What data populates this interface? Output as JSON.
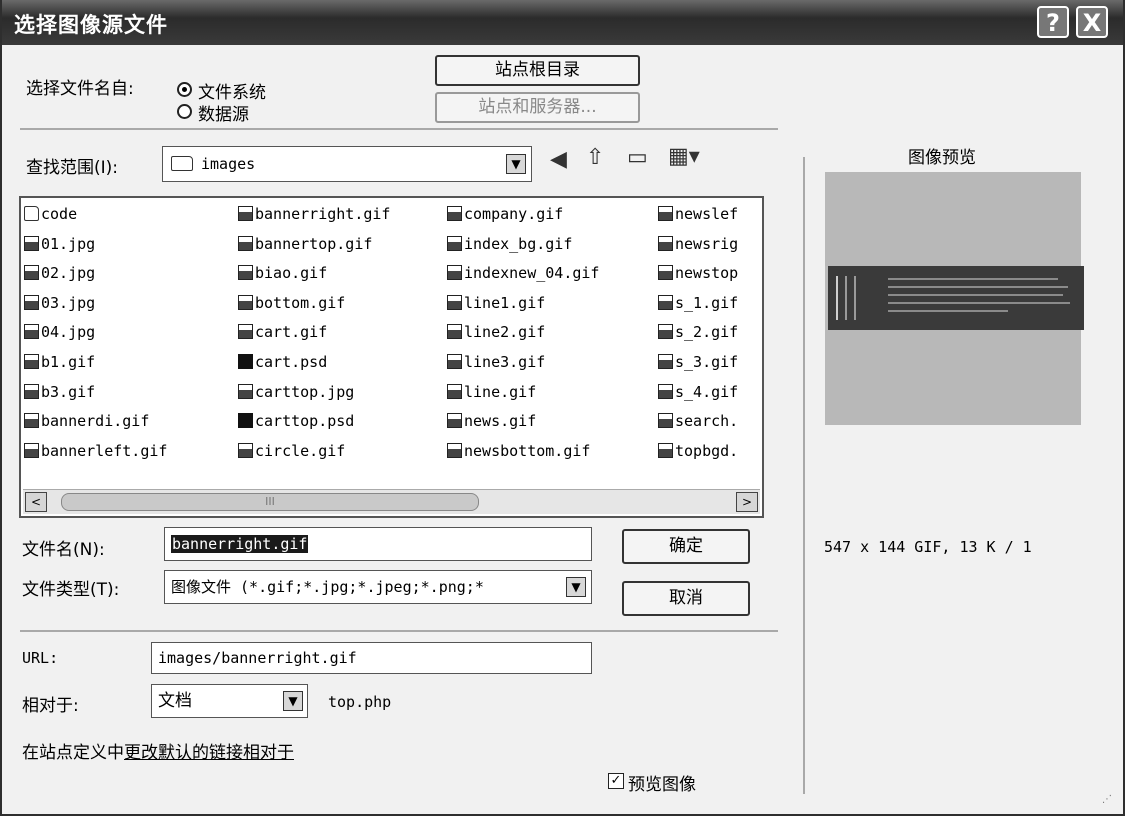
{
  "window": {
    "title": "选择图像源文件",
    "help_glyph": "?",
    "close_glyph": "X"
  },
  "source": {
    "label": "选择文件名自:",
    "options": [
      "文件系统",
      "数据源"
    ],
    "selected": "文件系统",
    "site_root_button": "站点根目录",
    "sites_servers_button": "站点和服务器..."
  },
  "lookin": {
    "label": "查找范围(I):",
    "value": "images"
  },
  "toolbar_icons": [
    "back-icon",
    "up-folder-icon",
    "new-folder-icon",
    "view-menu-icon"
  ],
  "files": {
    "columns": [
      [
        {
          "name": "code",
          "icon": "folder"
        },
        {
          "name": "01.jpg",
          "icon": "image"
        },
        {
          "name": "02.jpg",
          "icon": "image"
        },
        {
          "name": "03.jpg",
          "icon": "image"
        },
        {
          "name": "04.jpg",
          "icon": "image"
        },
        {
          "name": "b1.gif",
          "icon": "image"
        },
        {
          "name": "b3.gif",
          "icon": "image"
        },
        {
          "name": "bannerdi.gif",
          "icon": "image"
        },
        {
          "name": "bannerleft.gif",
          "icon": "image"
        }
      ],
      [
        {
          "name": "bannerright.gif",
          "icon": "image"
        },
        {
          "name": "bannertop.gif",
          "icon": "image"
        },
        {
          "name": "biao.gif",
          "icon": "image"
        },
        {
          "name": "bottom.gif",
          "icon": "image"
        },
        {
          "name": "cart.gif",
          "icon": "image"
        },
        {
          "name": "cart.psd",
          "icon": "psd"
        },
        {
          "name": "carttop.jpg",
          "icon": "image"
        },
        {
          "name": "carttop.psd",
          "icon": "psd"
        },
        {
          "name": "circle.gif",
          "icon": "image"
        }
      ],
      [
        {
          "name": "company.gif",
          "icon": "image"
        },
        {
          "name": "index_bg.gif",
          "icon": "image"
        },
        {
          "name": "indexnew_04.gif",
          "icon": "image"
        },
        {
          "name": "line1.gif",
          "icon": "image"
        },
        {
          "name": "line2.gif",
          "icon": "image"
        },
        {
          "name": "line3.gif",
          "icon": "image"
        },
        {
          "name": "line.gif",
          "icon": "image"
        },
        {
          "name": "news.gif",
          "icon": "image"
        },
        {
          "name": "newsbottom.gif",
          "icon": "image"
        }
      ],
      [
        {
          "name": "newslef",
          "icon": "image"
        },
        {
          "name": "newsrig",
          "icon": "image"
        },
        {
          "name": "newstop",
          "icon": "image"
        },
        {
          "name": "s_1.gif",
          "icon": "image"
        },
        {
          "name": "s_2.gif",
          "icon": "image"
        },
        {
          "name": "s_3.gif",
          "icon": "image"
        },
        {
          "name": "s_4.gif",
          "icon": "image"
        },
        {
          "name": "search.",
          "icon": "image"
        },
        {
          "name": "topbgd.",
          "icon": "image"
        }
      ]
    ],
    "scroll_left": "<",
    "scroll_right": ">",
    "scroll_grip": "III"
  },
  "filename": {
    "label": "文件名(N):",
    "value": "bannerright.gif"
  },
  "filetype": {
    "label": "文件类型(T):",
    "value": "图像文件 (*.gif;*.jpg;*.jpeg;*.png;*"
  },
  "buttons": {
    "ok": "确定",
    "cancel": "取消"
  },
  "url": {
    "label": "URL:",
    "value": "images/bannerright.gif"
  },
  "relative": {
    "label": "相对于:",
    "value": "文档",
    "file": "top.php"
  },
  "site_note": {
    "prefix": "在站点定义中",
    "link": "更改默认的链接相对于"
  },
  "preview": {
    "title": "图像预览",
    "info": "547 x 144 GIF, 13 K / 1",
    "checkbox_label": "预览图像",
    "checked": true,
    "check_glyph": "✓"
  },
  "colors": {
    "titlebar": "#2b2b2b",
    "dialog_bg": "#f1f1f1",
    "selection": "#1a1a1a"
  }
}
